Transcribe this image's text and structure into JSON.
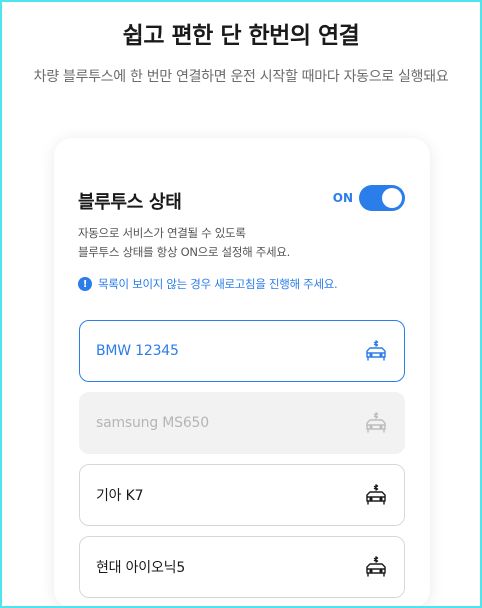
{
  "header": {
    "title": "쉽고 편한 단 한번의 연결",
    "subtitle": "차량 블루투스에 한 번만 연결하면 운전 시작할 때마다 자동으로 실행돼요"
  },
  "card": {
    "title": "블루투스 상태",
    "toggle": {
      "state_label": "ON",
      "on": true
    },
    "description_line1": "자동으로 서비스가 연결될 수 있도록",
    "description_line2": "블루투스 상태를 항상 ON으로 설정해 주세요.",
    "notice": "목록이 보이지 않는 경우 새로고침을 진행해 주세요.",
    "notice_icon": "info-icon",
    "devices": [
      {
        "name": "BMW 12345",
        "state": "selected",
        "icon": "car-bluetooth-icon"
      },
      {
        "name": "samsung MS650",
        "state": "disabled",
        "icon": "car-bluetooth-icon"
      },
      {
        "name": "기아 K7",
        "state": "normal",
        "icon": "car-bluetooth-icon"
      },
      {
        "name": "현대 아이오닉5",
        "state": "normal",
        "icon": "car-bluetooth-icon"
      }
    ]
  },
  "colors": {
    "accent": "#2b7de9",
    "frame_border": "#4ee6ec",
    "disabled_bg": "#f2f2f2"
  }
}
